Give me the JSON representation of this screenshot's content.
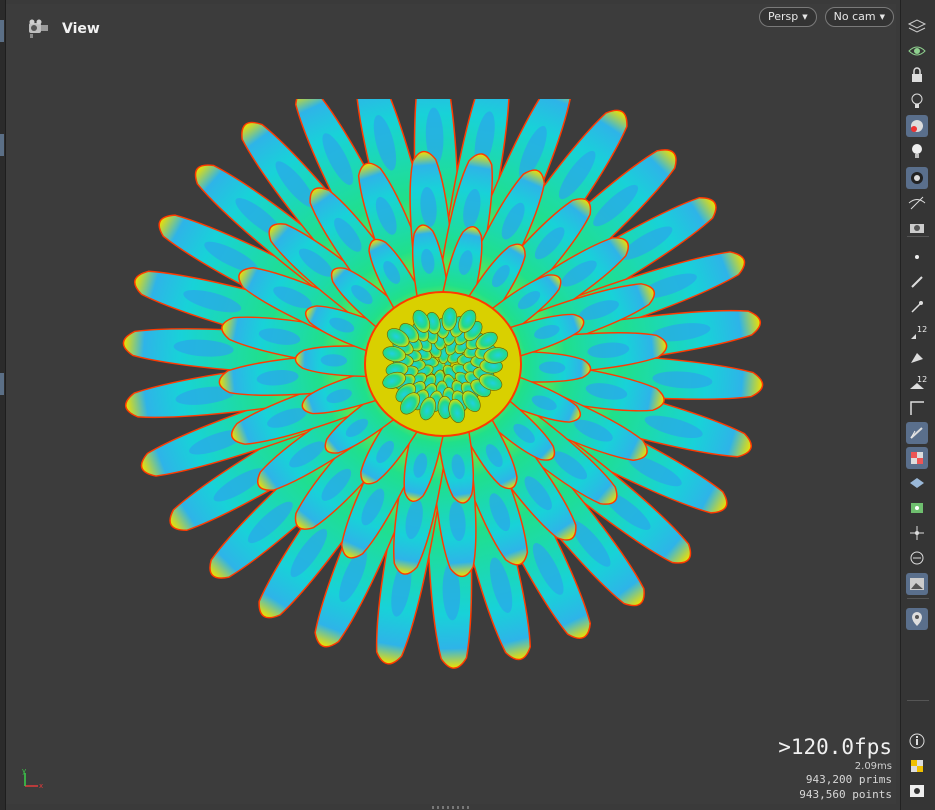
{
  "viewport": {
    "title": "View"
  },
  "camera": {
    "persp_label": "Persp",
    "cam_label": "No cam"
  },
  "stats": {
    "fps": ">120.0fps",
    "frame_time": "2.09ms",
    "prims": "943,200  prims",
    "points": "943,560 points"
  },
  "axes": {
    "x": "x",
    "y": "y"
  },
  "toolbar": {
    "items": [
      "display-options-icon",
      "visibility-icon",
      "lock-icon",
      "light-icon",
      "render-icon",
      "bulb-icon",
      "camera-shading-icon",
      "eye-tool-icon",
      "snapshot-icon",
      "point-icon",
      "brush-icon",
      "pick-icon",
      "number-12-icon",
      "paint-icon",
      "number-12b-icon",
      "angle-icon",
      "guide-icon",
      "checker-icon",
      "layer-icon",
      "uv-icon",
      "joint-icon",
      "list-icon",
      "background-icon",
      "pin-icon",
      "info-icon",
      "color-palette-icon",
      "eye-icon"
    ]
  },
  "colors": {
    "background": "#3c3c3c",
    "petal_center": "#1ec8e6",
    "petal_mid": "#22e07a",
    "petal_edge_yellow": "#f4e600",
    "petal_edge_red": "#ff3a00",
    "toolbar_active": "#5a6f8c"
  }
}
